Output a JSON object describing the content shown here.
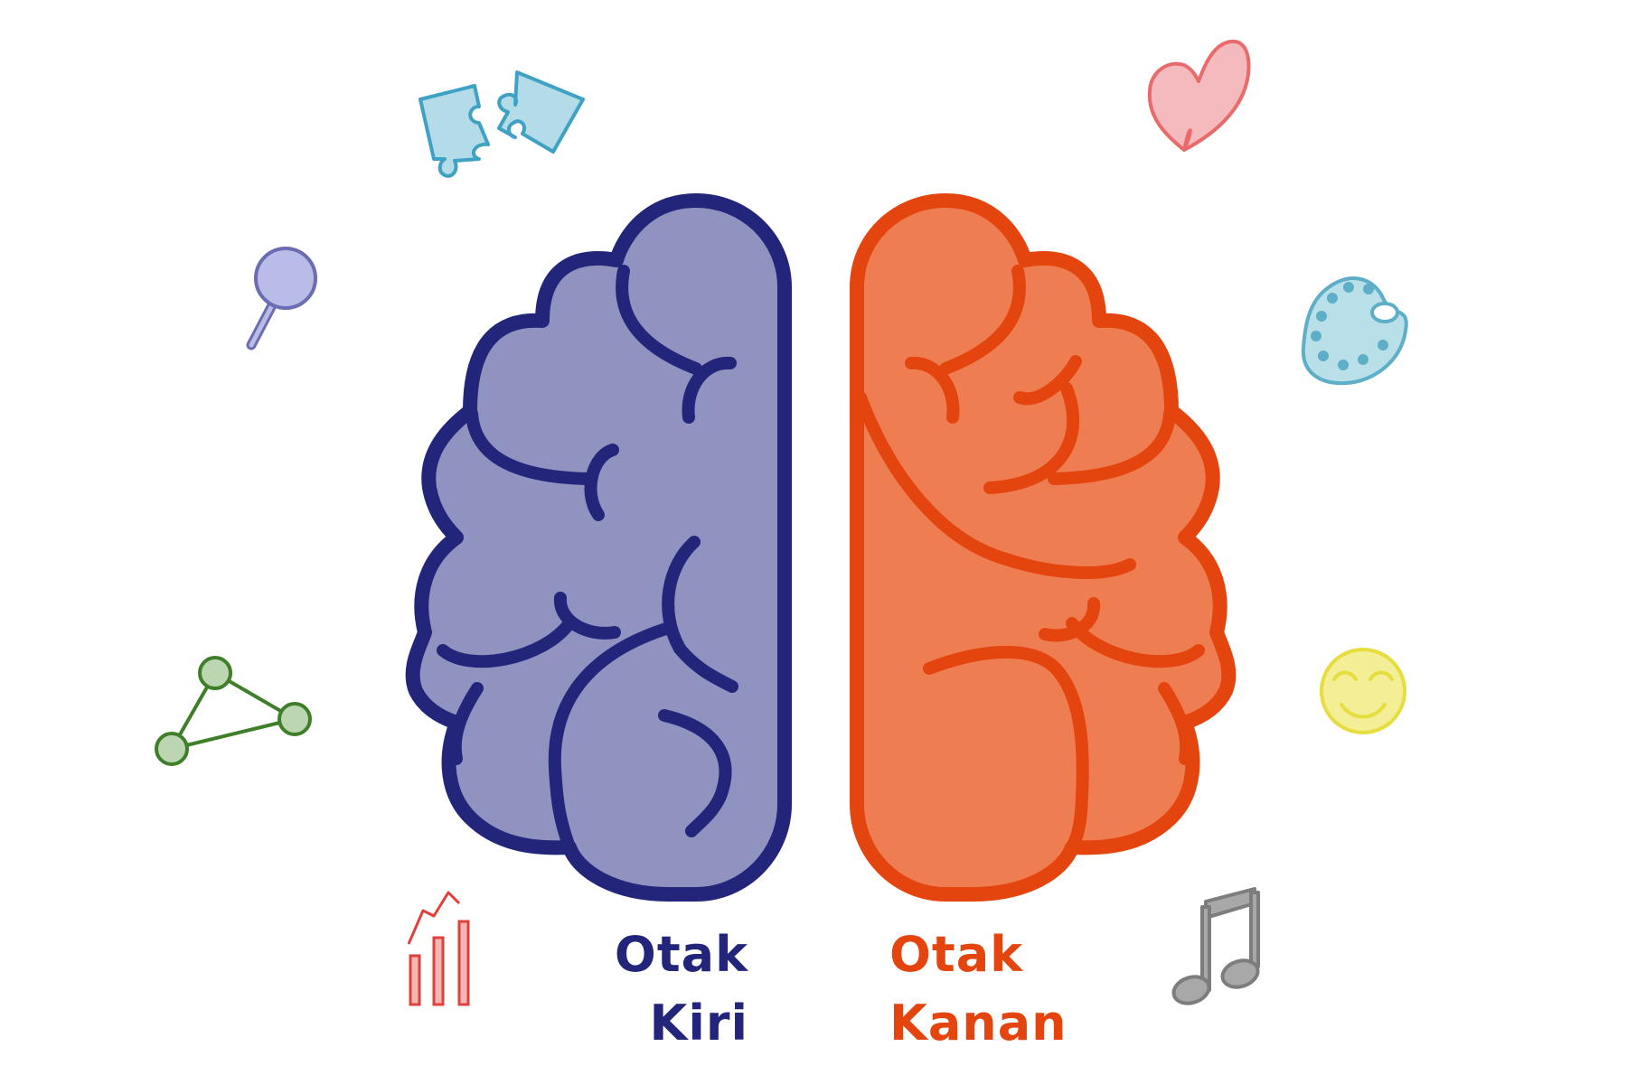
{
  "labels": {
    "left": {
      "line1": "Otak",
      "line2": "Kiri"
    },
    "right": {
      "line1": "Otak",
      "line2": "Kanan"
    }
  },
  "colors": {
    "left_fill": "#9093bf",
    "left_stroke": "#23257a",
    "right_fill": "#ee7e52",
    "right_stroke": "#e4450e",
    "puzzle": "#3fa2c4",
    "puzzle_fill": "#b4dce8",
    "magnifier": "#6b6db2",
    "magnifier_fill": "#b9bce6",
    "network": "#3f7f2a",
    "network_fill": "#bcd6b1",
    "chart": "#e0403c",
    "chart_fill": "#f4b7b5",
    "heart": "#e86a6a",
    "heart_fill": "#f4babd",
    "palette": "#5eaec8",
    "palette_fill": "#b9dfe9",
    "smiley": "#e6dd3e",
    "smiley_fill": "#f4ee96",
    "note": "#7d7d7d",
    "note_fill": "#a8a8a8"
  },
  "icons": {
    "left_side": [
      "puzzle-icon",
      "magnifier-icon",
      "network-icon",
      "bar-chart-icon"
    ],
    "right_side": [
      "heart-icon",
      "palette-icon",
      "smiley-icon",
      "music-note-icon"
    ]
  }
}
